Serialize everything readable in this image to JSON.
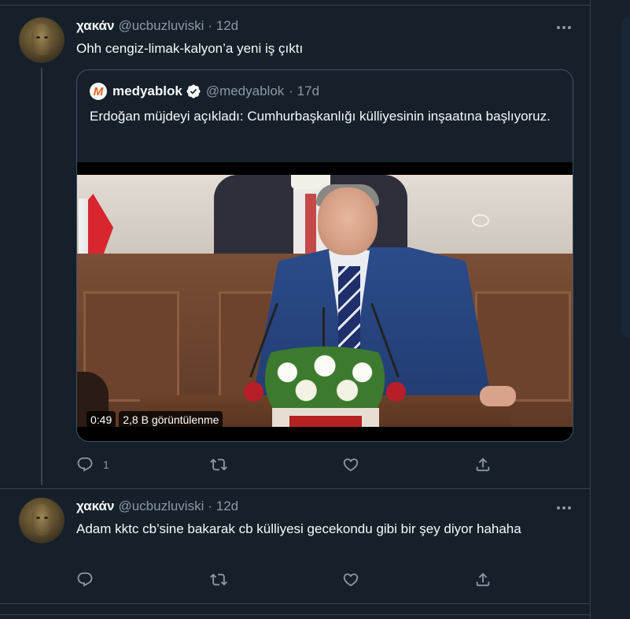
{
  "tweets": [
    {
      "name": "χακάν",
      "handle": "@ucbuzluviski",
      "time": "· 12d",
      "text": "Ohh cengiz-limak-kalyon’a yeni iş çıktı",
      "reply_count": "1",
      "quote": {
        "logo_letter": "M",
        "name": "medyablok",
        "handle": "@medyablok",
        "time": "· 17d",
        "text": "Erdoğan müjdeyi açıkladı: Cumhurbaşkanlığı külliyesinin inşaatına başlıyoruz.",
        "video_duration": "0:49",
        "video_views": "2,8 B görüntülenme"
      }
    },
    {
      "name": "χακάν",
      "handle": "@ucbuzluviski",
      "time": "· 12d",
      "text": "Adam kktc cb’sine bakarak cb külliyesi gecekondu gibi bir şey diyor hahaha"
    }
  ],
  "colors": {
    "background": "#15202b",
    "border": "#38444d",
    "secondary_text": "#8b98a5",
    "verified": "#f7f9f9",
    "quote_logo": "#e8661a"
  },
  "icons": {
    "reply": "reply-icon",
    "retweet": "retweet-icon",
    "like": "heart-icon",
    "share": "share-icon",
    "more": "more-icon",
    "verified": "verified-badge-icon"
  }
}
